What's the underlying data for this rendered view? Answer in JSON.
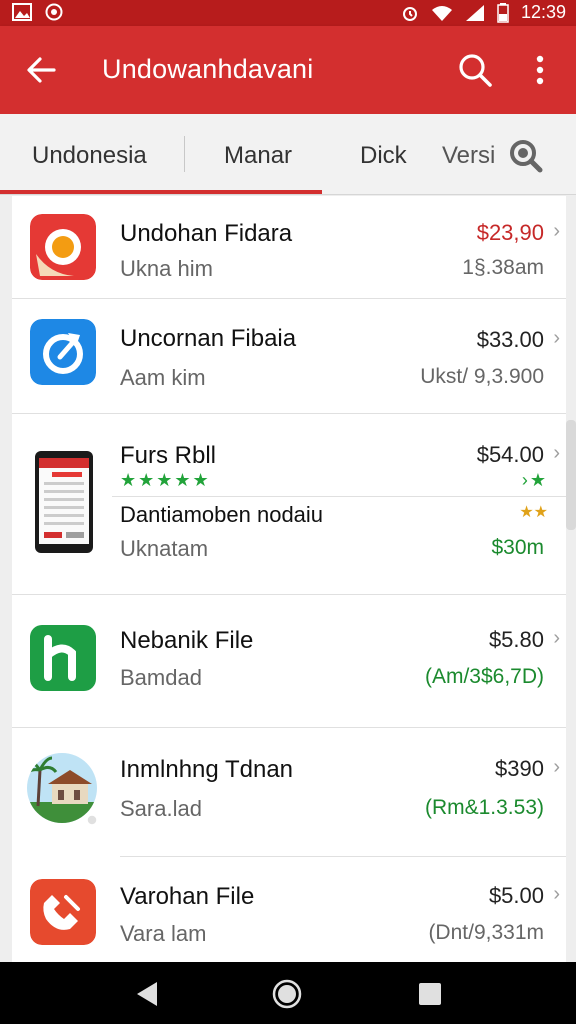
{
  "status": {
    "time": "12:39"
  },
  "appbar": {
    "title": "Undowanhdavani"
  },
  "tabs": [
    {
      "label": "Undonesia"
    },
    {
      "label": "Manar"
    },
    {
      "label": "Dick"
    },
    {
      "label": "Versi"
    }
  ],
  "items": [
    {
      "title": "Undohan Fidara",
      "subtitle": "Ukna him",
      "price": "$23,90",
      "detail": "1§.38am"
    },
    {
      "title": "Uncornan Fibaia",
      "subtitle": "Aam kim",
      "price": "$33.00",
      "detail": "Ukst/ 9,3.900"
    },
    {
      "title": "Furs Rbll",
      "subtitle2": "Dantiamoben nodaiu",
      "subtitle": "Uknatam",
      "price": "$54.00",
      "detail": "$30m"
    },
    {
      "title": "Nebanik File",
      "subtitle": "Bamdad",
      "price": "$5.80",
      "detail": "(Am/3$6,7D)"
    },
    {
      "title": "Inmlnhng Tdnan",
      "subtitle": "Sara.lad",
      "price": "$390",
      "detail": "(Rm&1.3.53)"
    },
    {
      "title": "Varohan File",
      "subtitle": "Vara lam",
      "price": "$5.00",
      "detail": "(Dnt/9,331m"
    }
  ],
  "colors": {
    "primary": "#d32f2f",
    "statusbar": "#b71c1c",
    "green": "#1b8a2e"
  },
  "icons": [
    "back-arrow-icon",
    "search-icon",
    "more-vert-icon",
    "tab-search-icon"
  ]
}
